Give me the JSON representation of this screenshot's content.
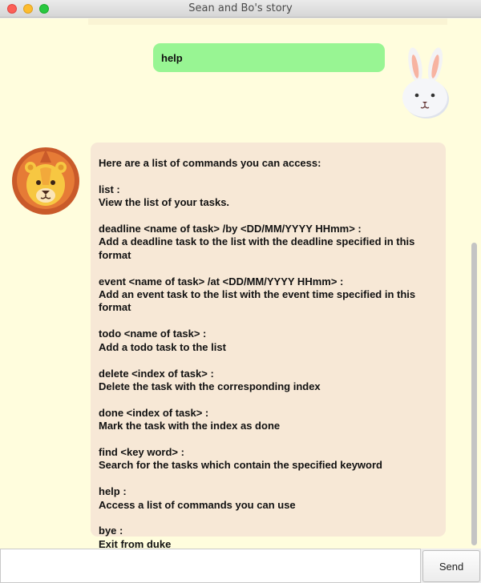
{
  "window": {
    "title": "Sean and Bo's story"
  },
  "colors": {
    "chat_background": "#fffddd",
    "user_bubble": "#98f593",
    "bot_bubble": "#f7e8d6"
  },
  "messages": [
    {
      "sender": "user",
      "avatar_icon": "bunny-avatar-icon",
      "text": "help"
    },
    {
      "sender": "bot",
      "avatar_icon": "lion-avatar-icon",
      "text": "Here are a list of commands you can access:\n\nlist :\nView the list of your tasks.\n\ndeadline <name of task> /by <DD/MM/YYYY HHmm> :\nAdd a deadline task to the list with the deadline specified in this format\n\nevent <name of task> /at <DD/MM/YYYY HHmm> :\nAdd an event task to the list with the event time specified in this format\n\ntodo <name of task> :\nAdd a todo task to the list\n\ndelete <index of task> :\nDelete the task with the corresponding index\n\ndone <index of task> :\nMark the task with the index as done\n\nfind <key word> :\nSearch for the tasks which contain the specified keyword\n\nhelp :\nAccess a list of commands you can use\n\nbye :\nExit from duke"
    }
  ],
  "input": {
    "value": "",
    "placeholder": ""
  },
  "send_button": {
    "label": "Send"
  }
}
